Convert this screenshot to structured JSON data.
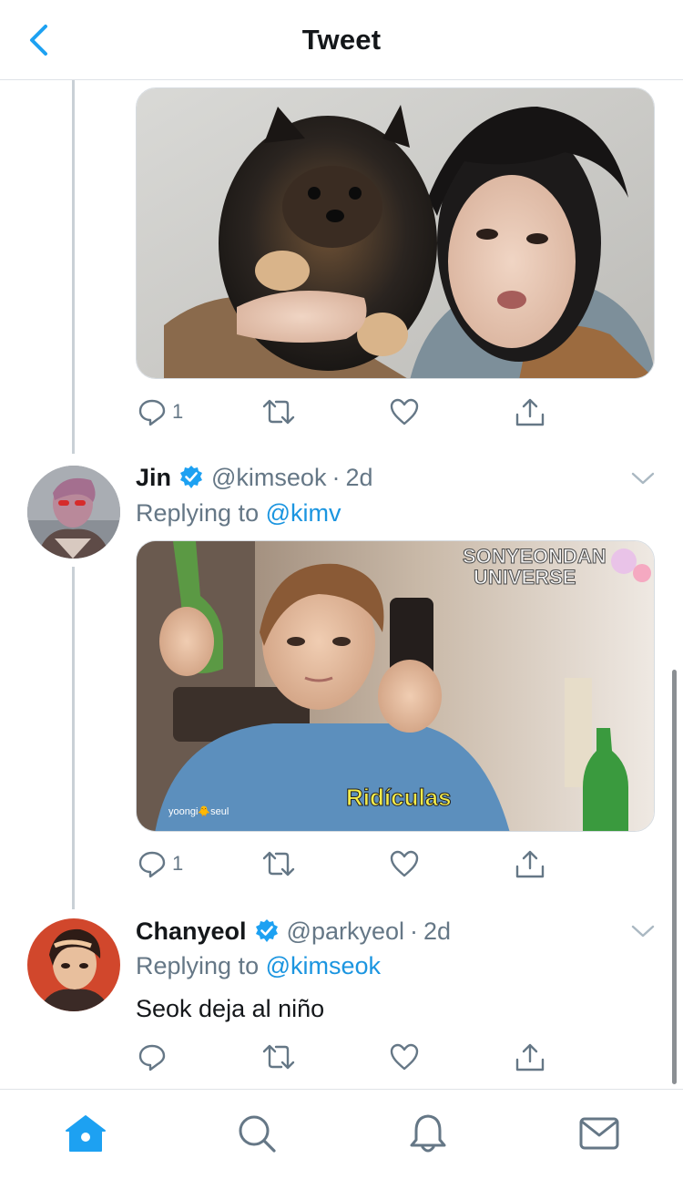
{
  "header": {
    "title": "Tweet",
    "back_icon": "chevron-left-icon"
  },
  "colors": {
    "accent": "#1da1f2",
    "mention": "#1b95e0",
    "muted": "#657786",
    "verified": "#1da1f2"
  },
  "tweets": [
    {
      "media": {
        "caption": ""
      },
      "actions": {
        "reply_count": "1"
      }
    },
    {
      "name": "Jin",
      "verified": true,
      "handle": "@kimseok",
      "dot": "·",
      "time": "2d",
      "replying_prefix": "Replying to",
      "replying_to": "@kimv",
      "media": {
        "watermark_line1": "SONYEONDAN",
        "watermark_line2": "UNIVERSE",
        "subtitle": "Ridículas",
        "corner_mark": "yoongi🐥seul"
      },
      "actions": {
        "reply_count": "1"
      }
    },
    {
      "name": "Chanyeol",
      "verified": true,
      "handle": "@parkyeol",
      "dot": "·",
      "time": "2d",
      "replying_prefix": "Replying to",
      "replying_to": "@kimseok",
      "text": "Seok deja al niño",
      "actions": {
        "reply_count": ""
      }
    }
  ],
  "tabbar": {
    "items": [
      {
        "icon": "home-icon",
        "active": true
      },
      {
        "icon": "search-icon",
        "active": false
      },
      {
        "icon": "bell-icon",
        "active": false
      },
      {
        "icon": "mail-icon",
        "active": false
      }
    ]
  }
}
